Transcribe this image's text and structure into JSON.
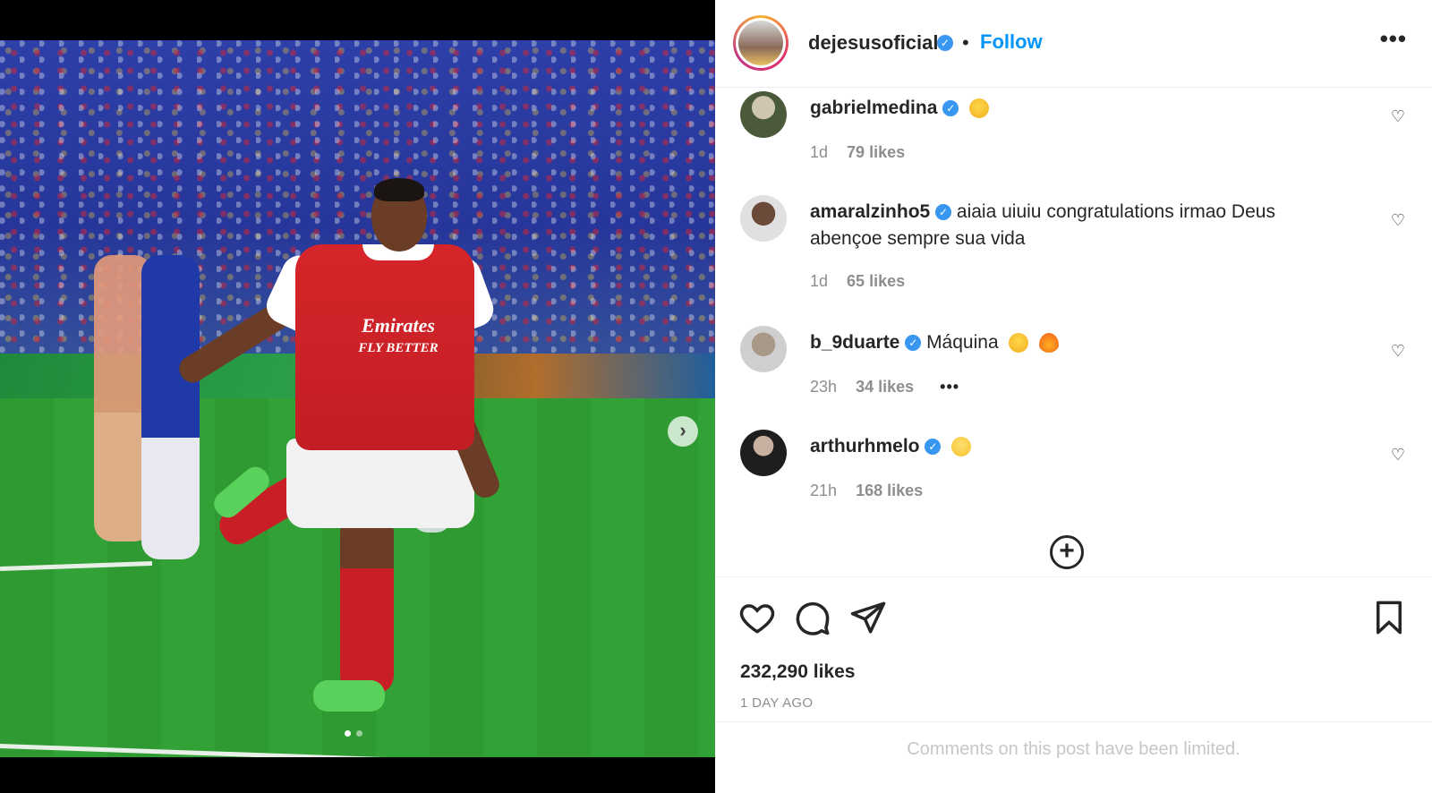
{
  "post": {
    "username": "dejesusoficial",
    "follow_label": "Follow",
    "separator": "•",
    "more_label": "•••",
    "next_label": "›"
  },
  "comments": [
    {
      "username": "gabrielmedina",
      "text": "",
      "emoji": [
        "raising-hands"
      ],
      "time": "1d",
      "likes": "79 likes",
      "avatar_color": "#4a5a3a"
    },
    {
      "username": "amaralzinho5",
      "text": "aiaia uiuiu congratulations irmao Deus abençoe sempre sua vida",
      "emoji": [],
      "time": "1d",
      "likes": "65 likes",
      "avatar_color": "#d8d8d8"
    },
    {
      "username": "b_9duarte",
      "text": "Máquina",
      "emoji": [
        "raising-hands",
        "fire"
      ],
      "time": "23h",
      "likes": "34 likes",
      "options": "•••",
      "avatar_color": "#bcbcbc"
    },
    {
      "username": "arthurhmelo",
      "text": "",
      "emoji": [
        "clapping-hands"
      ],
      "time": "21h",
      "likes": "168 likes",
      "avatar_color": "#2a2a2a"
    }
  ],
  "load_more_label": "+",
  "actions": {
    "likes_total": "232,290 likes",
    "date": "1 DAY AGO"
  },
  "footer": {
    "limited_text": "Comments on this post have been limited."
  },
  "colors": {
    "follow_blue": "#0095f6",
    "verified_blue": "#3897f0",
    "muted_text": "#8e8e8e"
  },
  "carousel": {
    "slides": 2,
    "active": 1
  }
}
